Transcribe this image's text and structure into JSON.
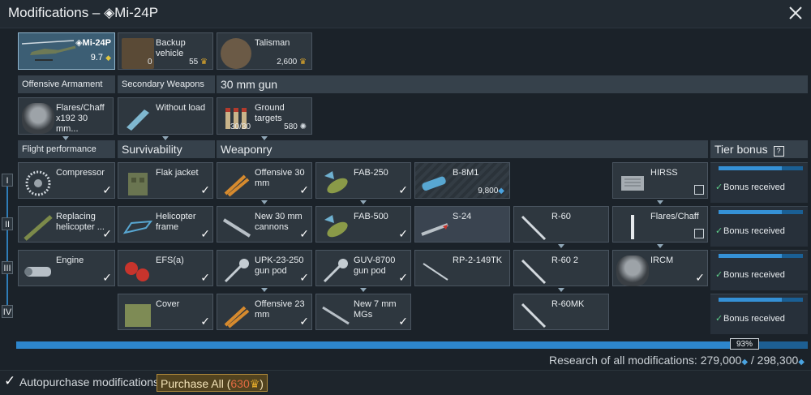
{
  "title": "Modifications – ◈Mi-24P",
  "unit": {
    "name": "◈Mi-24P",
    "br": "9.7"
  },
  "crew": [
    {
      "label": "Backup vehicle",
      "count": "0",
      "price": "55"
    },
    {
      "label": "Talisman",
      "price": "2,600"
    }
  ],
  "sections_top": [
    "Offensive Armament",
    "Secondary Weapons",
    "30 mm gun"
  ],
  "top_mods": [
    {
      "label": "Flares/Chaff x192 30 mm..."
    },
    {
      "label": "Without load"
    },
    {
      "label": "Ground targets",
      "count": "30/30",
      "price": "580"
    }
  ],
  "sections_main": [
    "Flight performance",
    "Survivability",
    "Weaponry",
    "Tier bonus"
  ],
  "tiers": [
    "I",
    "II",
    "III",
    "IV"
  ],
  "flight": [
    "Compressor",
    "Replacing helicopter ...",
    "Engine"
  ],
  "survivability": [
    "Flak jacket",
    "Helicopter frame",
    "EFS(a)",
    "Cover"
  ],
  "weaponry": {
    "col1": [
      "Offensive 30 mm",
      "New 30 mm cannons",
      "UPK-23-250 gun pod",
      "Offensive 23 mm"
    ],
    "col2": [
      "FAB-250",
      "FAB-500",
      "GUV-8700 gun pod",
      "New 7 mm MGs"
    ],
    "col3": [
      "B-8M1",
      "S-24",
      "RP-2-149TK"
    ],
    "col3_price": "9,800",
    "col4": [
      "R-60",
      "R-60 2",
      "R-60MK"
    ],
    "col5": [
      "HIRSS",
      "Flares/Chaff",
      "IRCM"
    ]
  },
  "bonus_text": "Bonus received",
  "progress_pct": "93%",
  "research_label": "Research of all modifications: 279,000",
  "research_total": "/ 298,300",
  "footer": {
    "autopurchase": "Autopurchase modifications",
    "purchase_prefix": "Purchase All (",
    "purchase_amount": "630",
    "purchase_suffix": ")"
  },
  "colors": {
    "accent": "#2d86cc",
    "gold": "#e0a82a",
    "bg": "#1b2229"
  }
}
